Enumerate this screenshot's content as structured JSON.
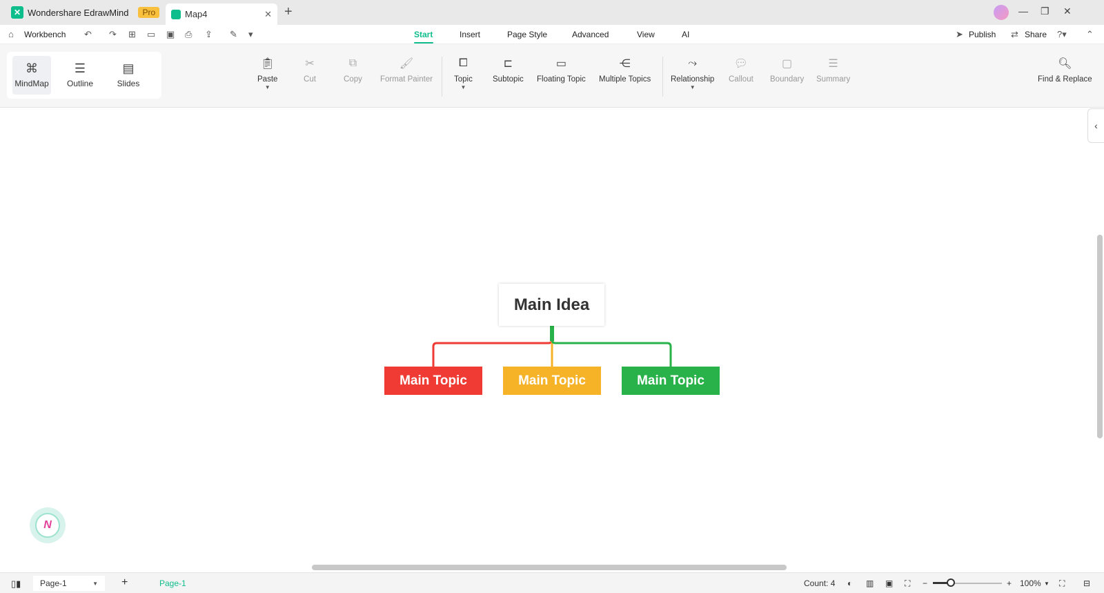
{
  "app": {
    "name": "Wondershare EdrawMind",
    "badge": "Pro",
    "doc_tab": "Map4"
  },
  "menu": {
    "workbench": "Workbench",
    "tabs": [
      "Start",
      "Insert",
      "Page Style",
      "Advanced",
      "View",
      "AI"
    ],
    "active_tab": "Start",
    "publish": "Publish",
    "share": "Share"
  },
  "views": {
    "mindmap": "MindMap",
    "outline": "Outline",
    "slides": "Slides"
  },
  "ribbon": {
    "paste": "Paste",
    "cut": "Cut",
    "copy": "Copy",
    "format_painter": "Format Painter",
    "topic": "Topic",
    "subtopic": "Subtopic",
    "floating_topic": "Floating Topic",
    "multiple_topics": "Multiple Topics",
    "relationship": "Relationship",
    "callout": "Callout",
    "boundary": "Boundary",
    "summary": "Summary",
    "find_replace": "Find & Replace"
  },
  "mindmap": {
    "central": "Main Idea",
    "topics": [
      {
        "label": "Main Topic",
        "color": "#ef3b33"
      },
      {
        "label": "Main Topic",
        "color": "#f6b328"
      },
      {
        "label": "Main Topic",
        "color": "#29b24a"
      }
    ]
  },
  "badge_logo": "N",
  "status": {
    "page_select": "Page-1",
    "page_tab": "Page-1",
    "count": "Count: 4",
    "zoom": "100%"
  },
  "colors": {
    "accent": "#0dbd8b"
  }
}
